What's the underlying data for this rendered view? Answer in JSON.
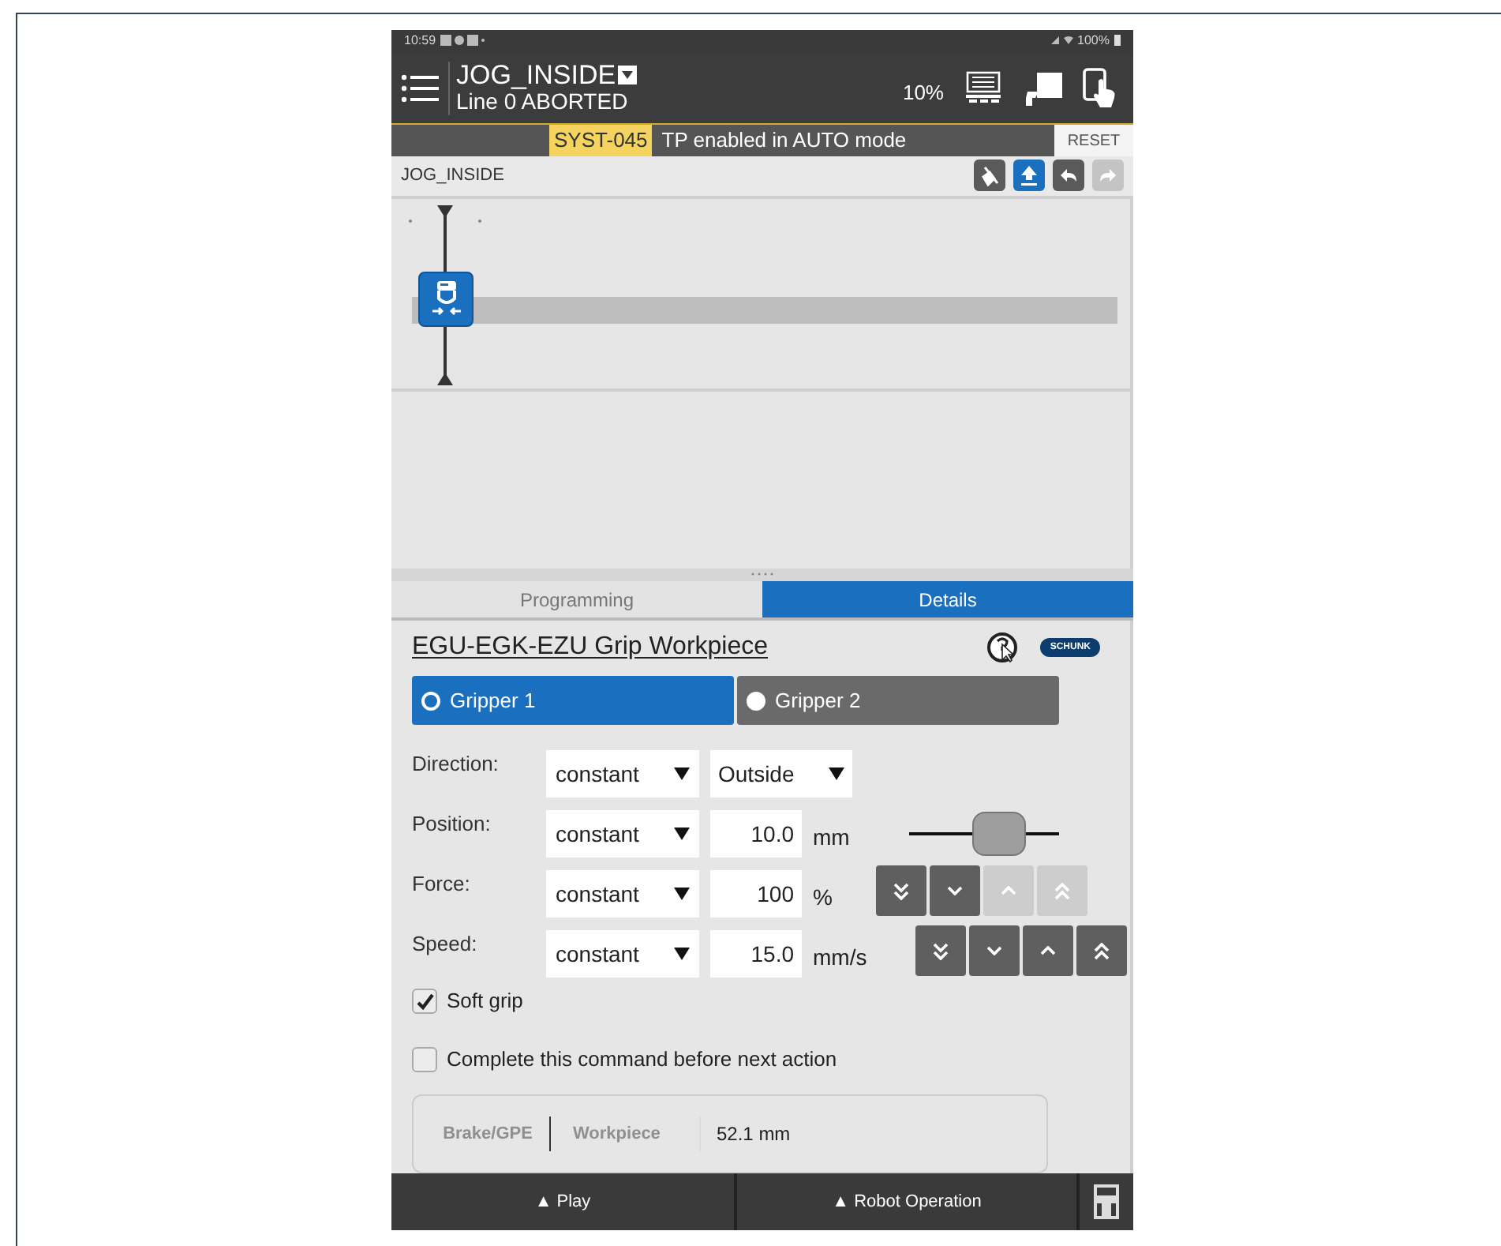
{
  "status_bar": {
    "time": "10:59",
    "battery": "100%"
  },
  "header": {
    "title": "JOG_INSIDE",
    "subtitle": "Line 0 ABORTED",
    "speed": "10%"
  },
  "alert": {
    "code": "SYST-045",
    "message": "TP enabled in AUTO mode",
    "action": "RESET"
  },
  "program": {
    "name": "JOG_INSIDE",
    "toolbar": [
      {
        "kind": "touchup",
        "disabled": false
      },
      {
        "kind": "upload",
        "disabled": false
      },
      {
        "kind": "undo",
        "disabled": false
      },
      {
        "kind": "redo",
        "disabled": true
      }
    ]
  },
  "tabs": [
    {
      "label": "Programming",
      "selected": false
    },
    {
      "label": "Details",
      "selected": true
    }
  ],
  "command": {
    "title": "EGU-EGK-EZU Grip Workpiece",
    "brand": "SCHUNK"
  },
  "grippers": [
    {
      "label": "Gripper 1",
      "selected": true
    },
    {
      "label": "Gripper 2",
      "selected": false
    }
  ],
  "parameters": [
    {
      "label": "Direction:",
      "mode": "constant",
      "kind": "choice",
      "value": "Outside"
    },
    {
      "label": "Position:",
      "mode": "constant",
      "kind": "slider",
      "value": "10.0",
      "unit": "mm",
      "level": 0.6
    },
    {
      "label": "Force:",
      "mode": "constant",
      "kind": "stepper",
      "value": "100",
      "unit": "%",
      "steps": [
        {
          "kind": "fast_down",
          "disabled": false
        },
        {
          "kind": "down",
          "disabled": false
        },
        {
          "kind": "up",
          "disabled": true
        },
        {
          "kind": "fast_up",
          "disabled": true
        }
      ]
    },
    {
      "label": "Speed:",
      "mode": "constant",
      "kind": "stepper",
      "value": "15.0",
      "unit": "mm/s",
      "steps": [
        {
          "kind": "fast_down",
          "disabled": false
        },
        {
          "kind": "down",
          "disabled": false
        },
        {
          "kind": "up",
          "disabled": false
        },
        {
          "kind": "fast_up",
          "disabled": false
        }
      ]
    }
  ],
  "options": [
    {
      "label": "Soft grip",
      "checked": true
    },
    {
      "label": "Complete this command before next action",
      "checked": false
    }
  ],
  "info": {
    "column_1": "Brake/GPE",
    "column_2": "Workpiece",
    "column_3": "52.1 mm"
  },
  "bottom_bar": [
    {
      "label": "▲ Play"
    },
    {
      "label": "▲ Robot Operation"
    }
  ]
}
